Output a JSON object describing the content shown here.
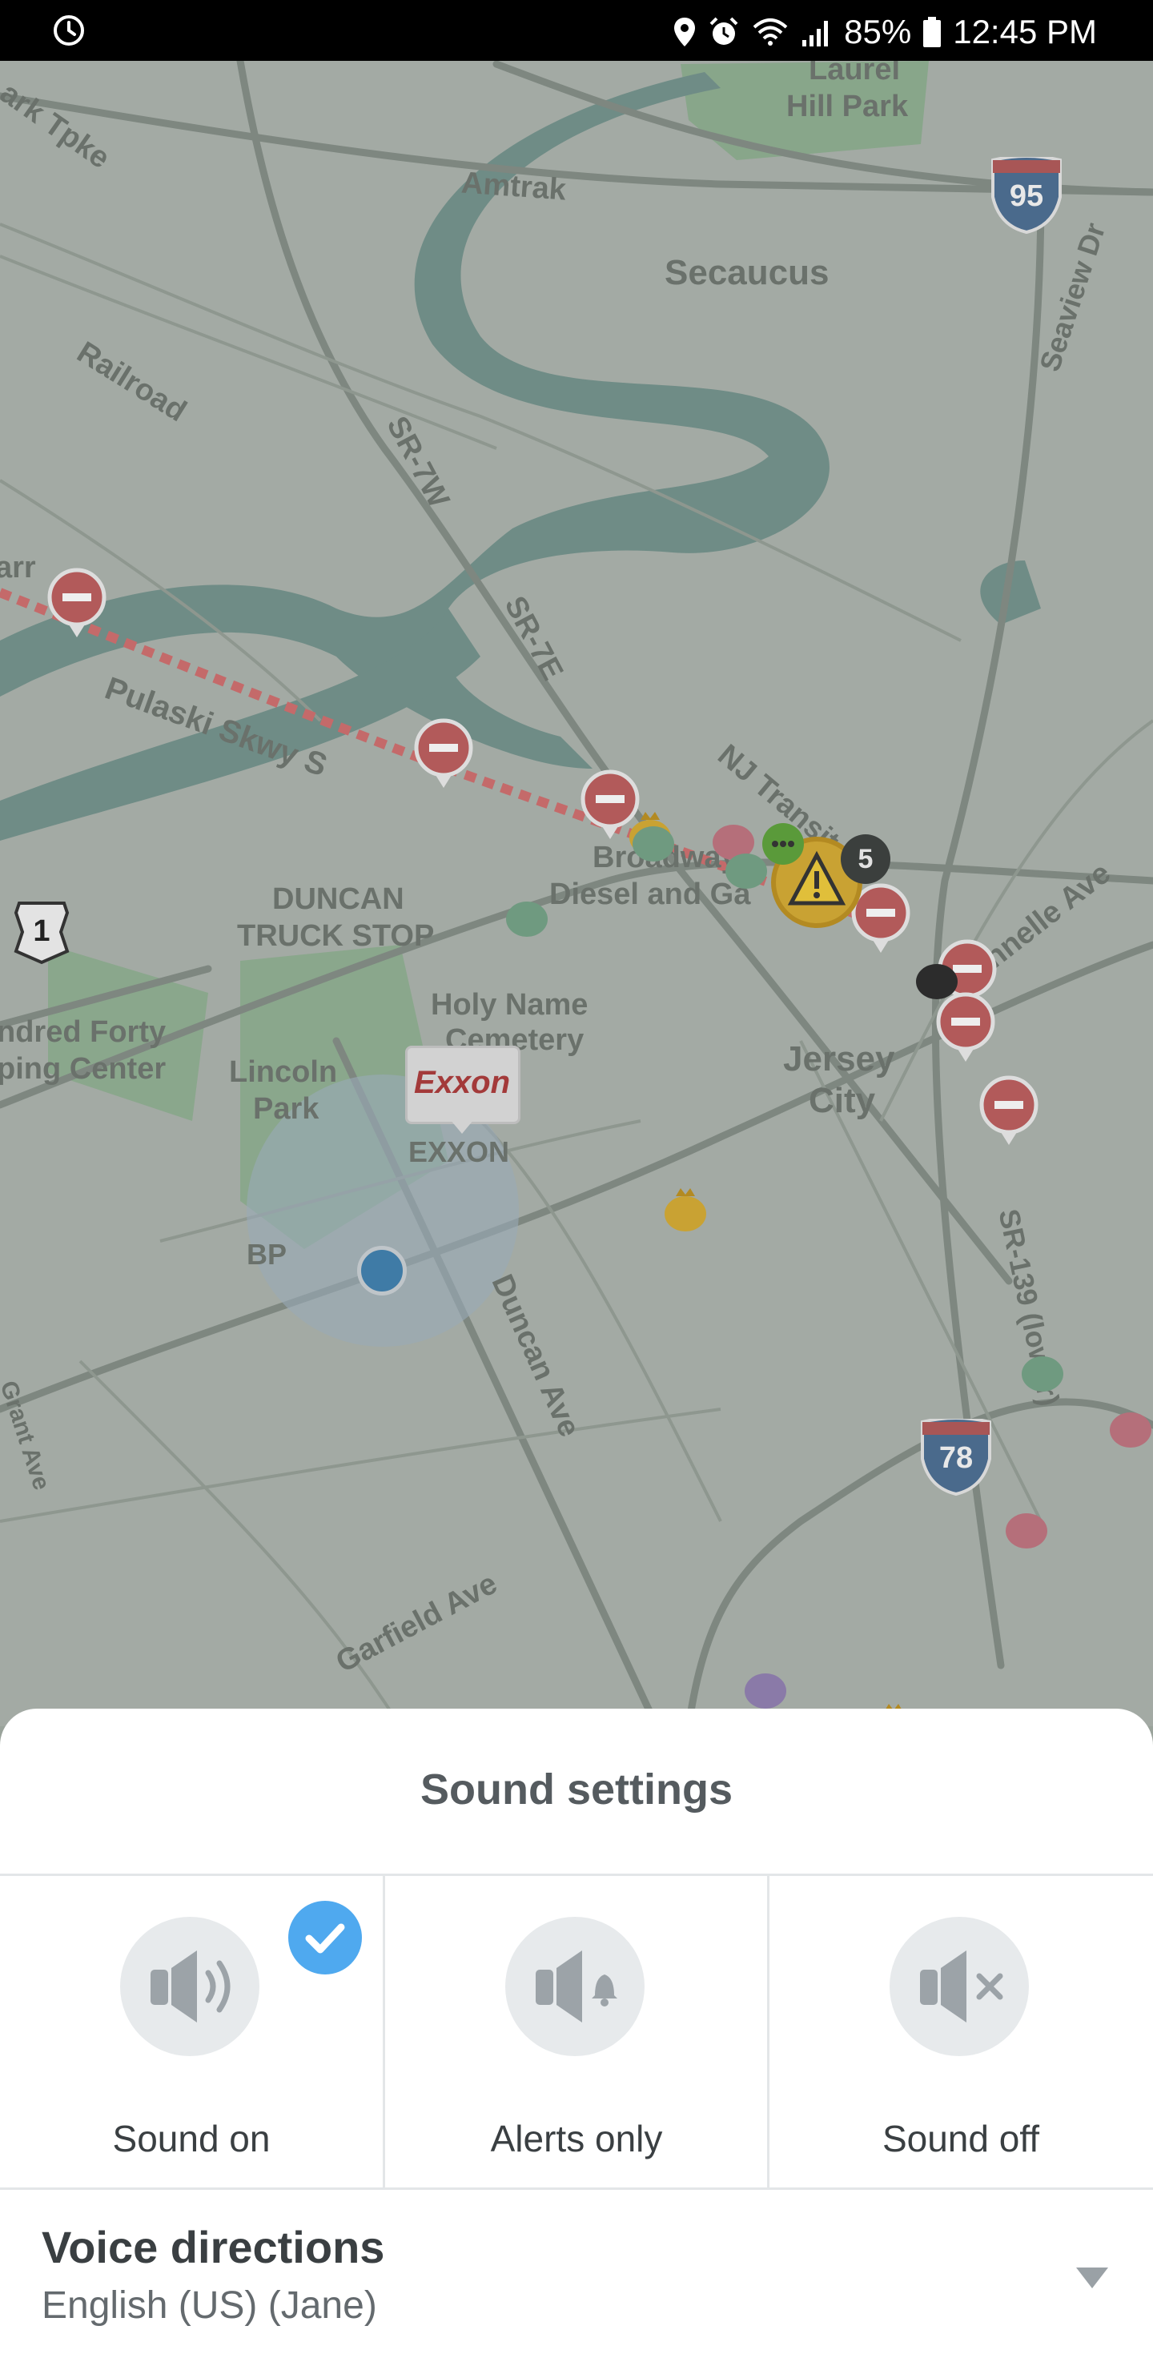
{
  "status_bar": {
    "battery": "85%",
    "time": "12:45 PM",
    "icons": [
      "sync-icon",
      "location-icon",
      "alarm-icon",
      "wifi-icon",
      "signal-icon",
      "battery-icon"
    ]
  },
  "map": {
    "labels": {
      "turnpike": "ark Tpke",
      "laurel_hill_1": "Laurel",
      "laurel_hill_2": "Hill Park",
      "amtrak": "Amtrak",
      "secaucus": "Secaucus",
      "railroad": "Railroad",
      "sr7w": "SR-7W",
      "seaview": "Seaview Dr",
      "sr7e": "SR-7E",
      "pulaski": "Pulaski Skwy S",
      "nj_transit": "NJ Transit",
      "broadway_1": "Broadway",
      "broadway_2": "Diesel and Ga",
      "duncan_1": "DUNCAN",
      "duncan_2": "TRUCK STOP",
      "tonnelle": "Tonnelle Ave",
      "holy_name_1": "Holy Name",
      "holy_name_2": "Cemetery",
      "hundred_1": "ndred Forty",
      "hundred_2": "ping Center",
      "lincoln_1": "Lincoln",
      "lincoln_2": "Park",
      "jersey_1": "Jersey",
      "jersey_2": "City",
      "exxon": "EXXON",
      "bp": "BP",
      "duncan_ave": "Duncan Ave",
      "sr139": "SR-139 (lower)",
      "grant_ave": "Grant Ave",
      "garfield": "Garfield Ave",
      "partial_left": "arr"
    },
    "shields": {
      "i95": "95",
      "us1": "1",
      "i78": "78"
    },
    "exxon_logo": "Exxon",
    "report_count": "5"
  },
  "sound_settings": {
    "title": "Sound settings",
    "options": [
      {
        "label": "Sound on",
        "icon": "speaker-on-icon",
        "selected": true
      },
      {
        "label": "Alerts only",
        "icon": "speaker-bell-icon",
        "selected": false
      },
      {
        "label": "Sound off",
        "icon": "speaker-mute-icon",
        "selected": false
      }
    ],
    "voice_directions": {
      "title": "Voice directions",
      "value": "English (US) (Jane)"
    }
  }
}
